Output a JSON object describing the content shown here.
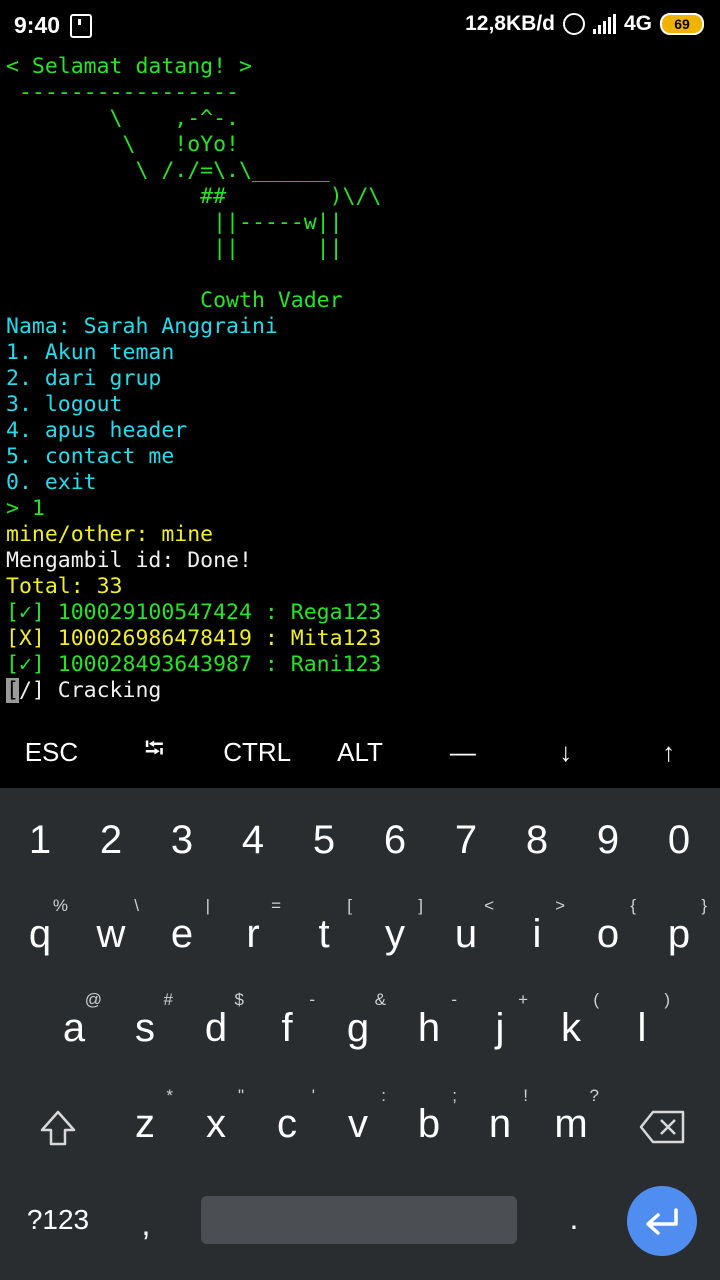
{
  "status_bar": {
    "time": "9:40",
    "network_speed": "12,8KB/d",
    "network_type": "4G",
    "battery": "69"
  },
  "terminal": {
    "lines": [
      {
        "text": "< Selamat datang! >",
        "color": "g"
      },
      {
        "text": " -----------------",
        "color": "g"
      },
      {
        "text": "        \\    ,-^-.",
        "color": "g"
      },
      {
        "text": "         \\   !oYo!",
        "color": "g"
      },
      {
        "text": "          \\ /./=\\.\\______",
        "color": "g"
      },
      {
        "text": "               ##        )\\/\\",
        "color": "g"
      },
      {
        "text": "                ||-----w||",
        "color": "g"
      },
      {
        "text": "                ||      ||",
        "color": "g"
      },
      {
        "text": "",
        "color": "g"
      },
      {
        "text": "               Cowth Vader",
        "color": "g"
      },
      {
        "text": "Nama: Sarah Anggraini",
        "color": "c"
      },
      {
        "text": "1. Akun teman",
        "color": "c"
      },
      {
        "text": "2. dari grup",
        "color": "c"
      },
      {
        "text": "3. logout",
        "color": "c"
      },
      {
        "text": "4. apus header",
        "color": "c"
      },
      {
        "text": "5. contact me",
        "color": "c"
      },
      {
        "text": "0. exit",
        "color": "c"
      },
      {
        "text": "> 1",
        "color": "g"
      },
      {
        "text": "mine/other: mine",
        "color": "y"
      },
      {
        "text": "Mengambil id: Done!",
        "color": "w"
      },
      {
        "text": "Total: 33",
        "color": "y"
      },
      {
        "text": "[✓] 100029100547424 : Rega123",
        "color": "g"
      },
      {
        "text": "[X] 100026986478419 : Mita123",
        "color": "y"
      },
      {
        "text": "[✓] 100028493643987 : Rani123",
        "color": "g"
      }
    ],
    "cursor_line": {
      "cursor_char": "[",
      "rest": "/] Cracking"
    }
  },
  "extra_keys": [
    "ESC",
    "⭾",
    "CTRL",
    "ALT",
    "—",
    "↓",
    "↑"
  ],
  "keyboard": {
    "row1": [
      {
        "m": "1"
      },
      {
        "m": "2"
      },
      {
        "m": "3"
      },
      {
        "m": "4"
      },
      {
        "m": "5"
      },
      {
        "m": "6"
      },
      {
        "m": "7"
      },
      {
        "m": "8"
      },
      {
        "m": "9"
      },
      {
        "m": "0"
      }
    ],
    "row2": [
      {
        "m": "q",
        "s": "%"
      },
      {
        "m": "w",
        "s": "\\"
      },
      {
        "m": "e",
        "s": "|"
      },
      {
        "m": "r",
        "s": "="
      },
      {
        "m": "t",
        "s": "["
      },
      {
        "m": "y",
        "s": "]"
      },
      {
        "m": "u",
        "s": "<"
      },
      {
        "m": "i",
        "s": ">"
      },
      {
        "m": "o",
        "s": "{"
      },
      {
        "m": "p",
        "s": "}"
      }
    ],
    "row3": [
      {
        "m": "a",
        "s": "@"
      },
      {
        "m": "s",
        "s": "#"
      },
      {
        "m": "d",
        "s": "$"
      },
      {
        "m": "f",
        "s": "-"
      },
      {
        "m": "g",
        "s": "&"
      },
      {
        "m": "h",
        "s": "-"
      },
      {
        "m": "j",
        "s": "+"
      },
      {
        "m": "k",
        "s": "("
      },
      {
        "m": "l",
        "s": ")"
      }
    ],
    "row4": [
      {
        "m": "z",
        "s": "*"
      },
      {
        "m": "x",
        "s": "\""
      },
      {
        "m": "c",
        "s": "'"
      },
      {
        "m": "v",
        "s": ":"
      },
      {
        "m": "b",
        "s": ";"
      },
      {
        "m": "n",
        "s": "!"
      },
      {
        "m": "m",
        "s": "?"
      }
    ],
    "symbols_label": "?123",
    "comma": ",",
    "period": "."
  }
}
